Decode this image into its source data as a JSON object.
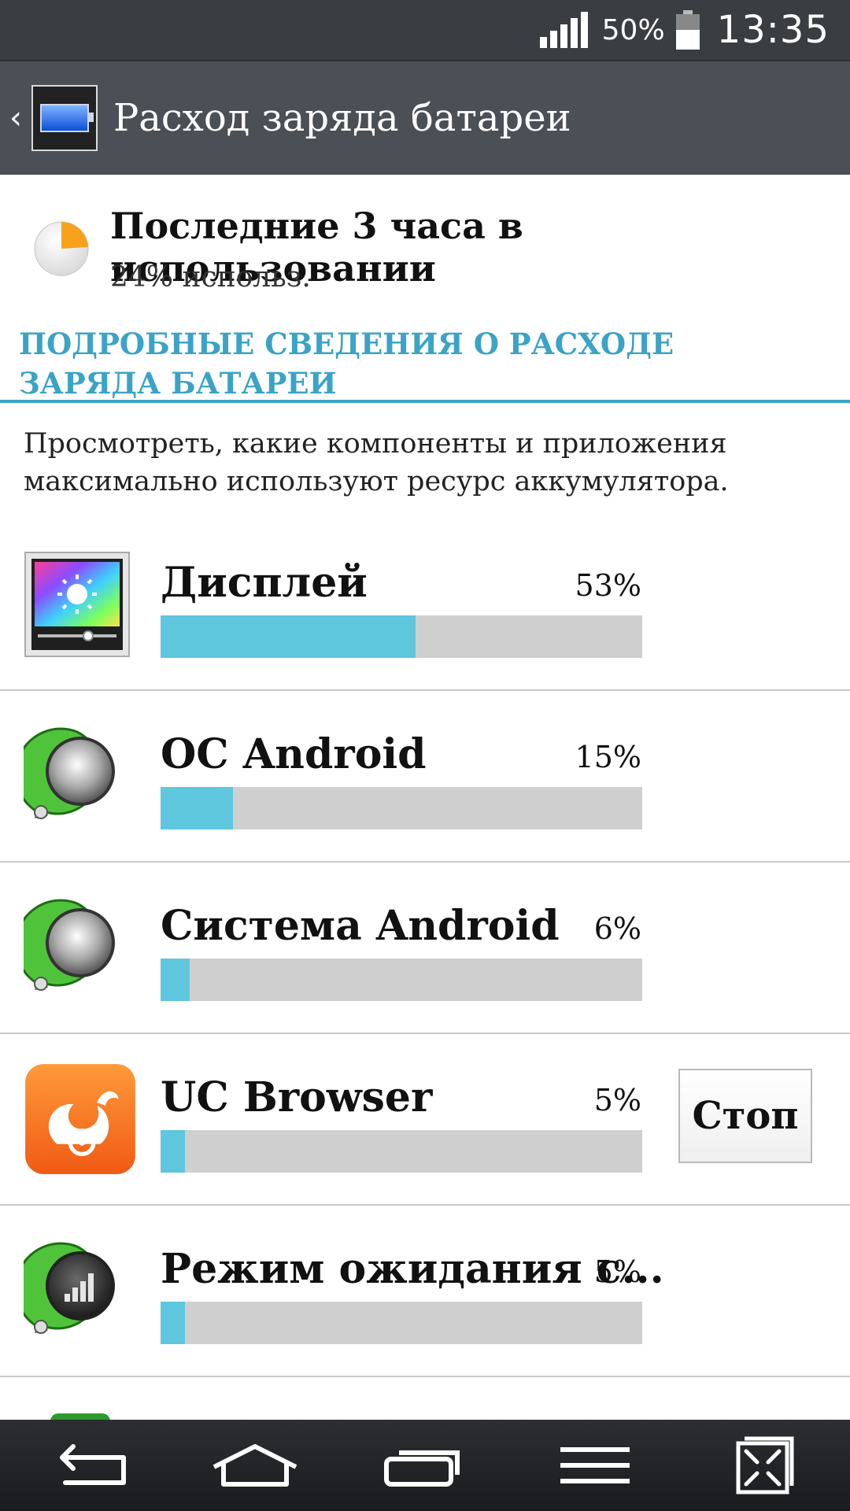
{
  "status_bar": {
    "battery_percent": "50%",
    "time": "13:35",
    "icons": [
      "signal-icon",
      "battery-icon"
    ]
  },
  "action_bar": {
    "title": "Расход заряда батареи",
    "icons": [
      "back-icon",
      "battery-app-icon"
    ]
  },
  "summary": {
    "title": "Последние 3 часа в использовании",
    "subtitle": "24% использ.",
    "usage_fraction": 0.24,
    "pie_color": "#f7a21b"
  },
  "section": {
    "title": "ПОДРОБНЫЕ СВЕДЕНИЯ О РАСХОДЕ ЗАРЯДА БАТАРЕИ",
    "description": "Просмотреть, какие компоненты и приложения максимально используют ресурс аккумулятора."
  },
  "accent_color": "#3aa3c6",
  "bar_color": "#5ec6dd",
  "items": [
    {
      "name": "Дисплей",
      "percent": "53%",
      "value": 53,
      "icon": "display-brightness-icon"
    },
    {
      "name": "ОС Android",
      "percent": "15%",
      "value": 15,
      "icon": "android-os-icon"
    },
    {
      "name": "Система Android",
      "percent": "6%",
      "value": 6,
      "icon": "android-system-icon"
    },
    {
      "name": "UC Browser",
      "percent": "5%",
      "value": 5,
      "icon": "uc-browser-icon",
      "button": "Стоп"
    },
    {
      "name": "Режим ожидания с...",
      "percent": "5%",
      "value": 5,
      "icon": "cell-standby-icon"
    }
  ],
  "nav_bar": {
    "buttons": [
      "back-icon",
      "home-icon",
      "recent-apps-icon",
      "menu-icon",
      "dual-window-icon"
    ]
  }
}
